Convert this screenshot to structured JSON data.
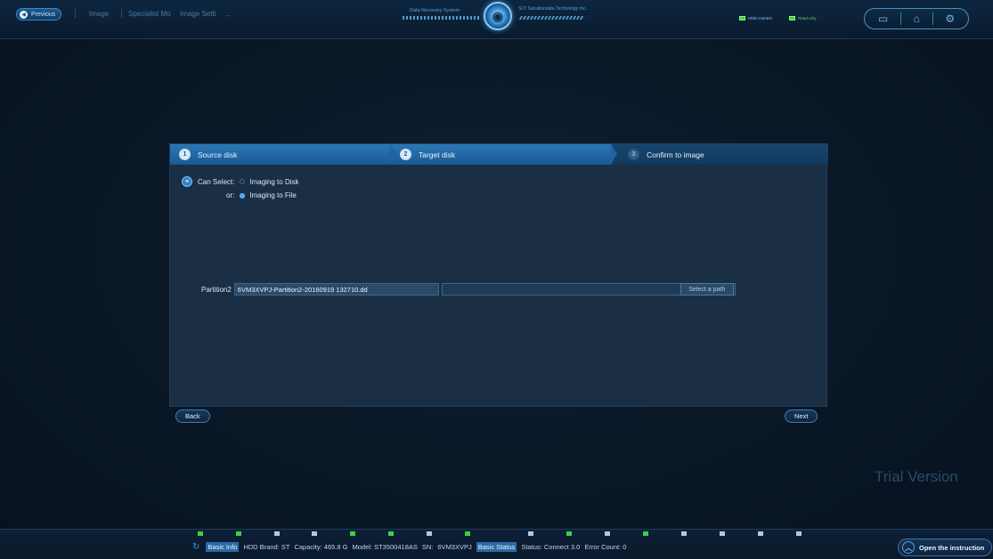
{
  "topbar": {
    "previous_label": "Previous",
    "crumbs": [
      "Image",
      "Specialist Mo",
      "Image Setti"
    ],
    "crumb_more": "...",
    "title_left": "Data Recovery System",
    "title_right": "SLY Salvationdata Technology Inc.",
    "hdd_connect": "HDD connect",
    "read_only": "Read-only"
  },
  "wizard": {
    "steps": [
      {
        "num": "1",
        "label": "Source disk"
      },
      {
        "num": "2",
        "label": "Target disk"
      },
      {
        "num": "3",
        "label": "Confirm to image"
      }
    ],
    "can_select_label": "Can Select:",
    "option_disk": "Imaging to Disk",
    "or_label": "or:",
    "option_file": "Imaging to File",
    "selected_option": "Imaging to File",
    "partition_label": "Partition2",
    "file_name": "6VM3XVPJ-Partition2-20160919 132710.dd",
    "path_value": "",
    "select_path_label": "Select a path",
    "back_label": "Back",
    "next_label": "Next"
  },
  "watermark": "Trial Version",
  "statusbar": {
    "basic_info_tag": "Basic Info",
    "hdd_brand": "HDD Brand: ST",
    "capacity": "Capacity: 465.8 G",
    "model": "Model: ST3500418AS",
    "sn_label": "SN:",
    "sn_value": "6VM3XVPJ",
    "basic_status_tag": "Basic Status",
    "status": "Status: Connect 3.0",
    "error_count": "Error Count: 0",
    "open_instruction": "Open the instruction"
  }
}
